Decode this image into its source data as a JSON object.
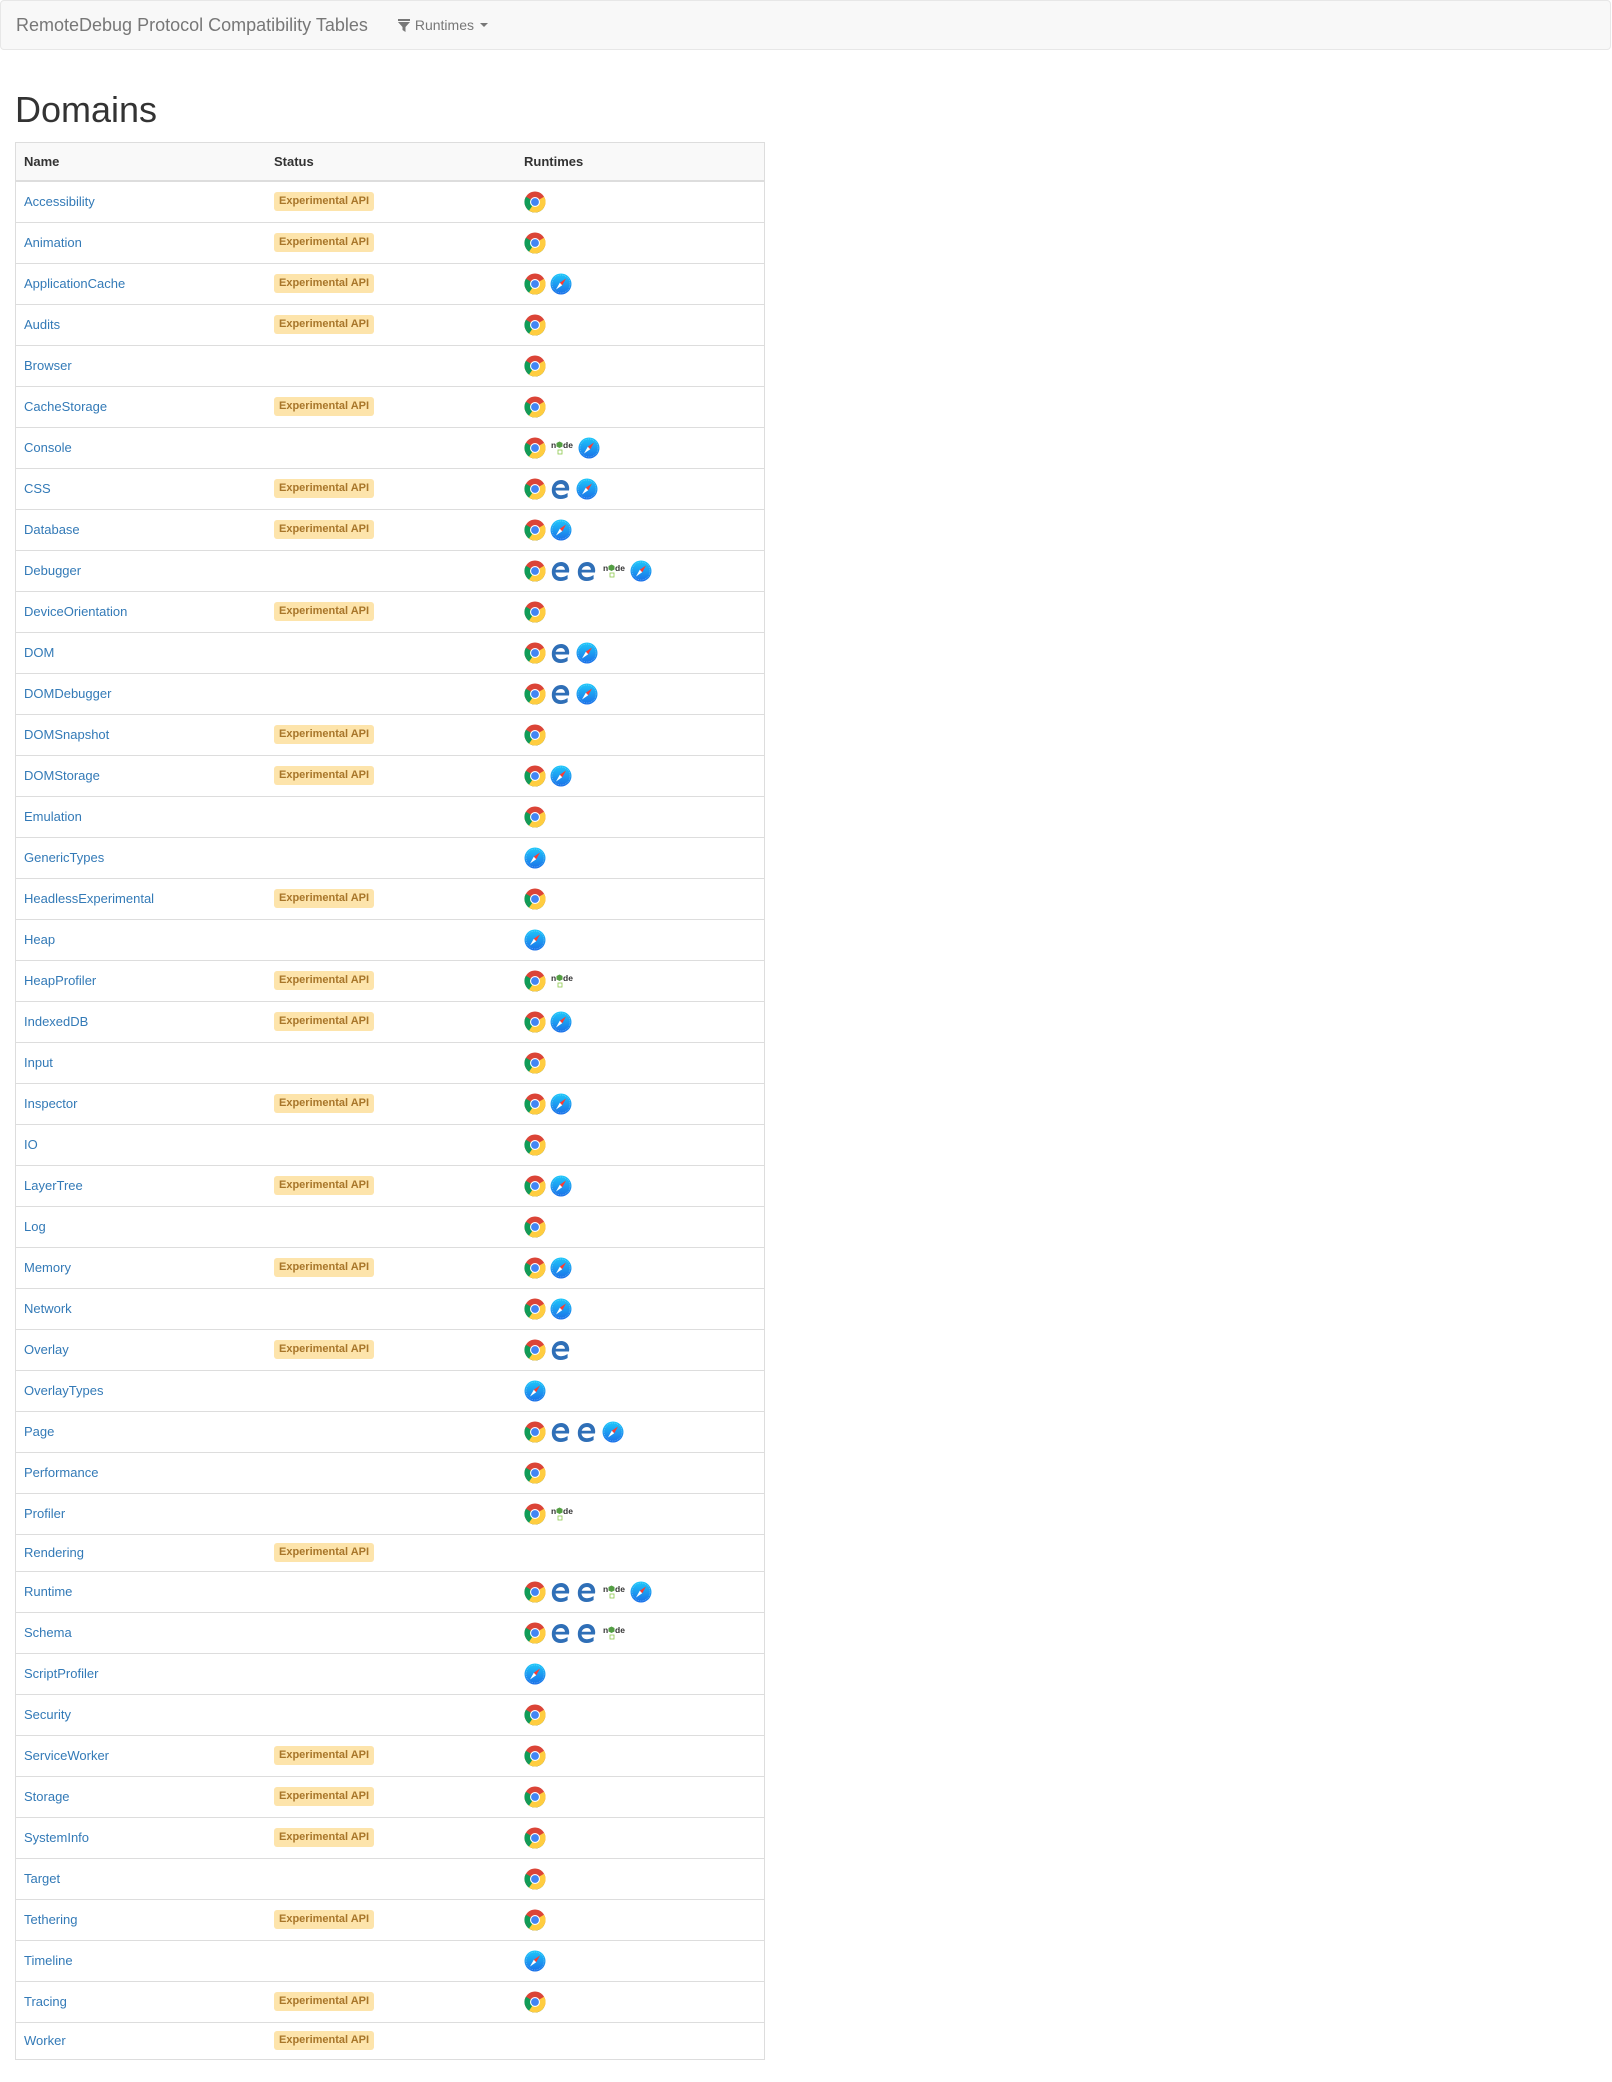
{
  "navbar": {
    "brand": "RemoteDebug Protocol Compatibility Tables",
    "runtimes_menu_label": "Runtimes",
    "runtimes_menu_icon": "filter-icon"
  },
  "page": {
    "title": "Domains"
  },
  "table": {
    "columns": [
      "Name",
      "Status",
      "Runtimes"
    ],
    "runtime_icons": {
      "chrome": "chrome-icon",
      "edge": "edge-icon",
      "node": "node-icon",
      "safari": "safari-icon"
    },
    "badge_color": "#fde4ab",
    "badge_text_color": "#a8762a",
    "link_color": "#337ab7",
    "rows": [
      {
        "name": "Accessibility",
        "status": "Experimental API",
        "runtimes": [
          "chrome"
        ]
      },
      {
        "name": "Animation",
        "status": "Experimental API",
        "runtimes": [
          "chrome"
        ]
      },
      {
        "name": "ApplicationCache",
        "status": "Experimental API",
        "runtimes": [
          "chrome",
          "safari"
        ]
      },
      {
        "name": "Audits",
        "status": "Experimental API",
        "runtimes": [
          "chrome"
        ]
      },
      {
        "name": "Browser",
        "status": "",
        "runtimes": [
          "chrome"
        ]
      },
      {
        "name": "CacheStorage",
        "status": "Experimental API",
        "runtimes": [
          "chrome"
        ]
      },
      {
        "name": "Console",
        "status": "",
        "runtimes": [
          "chrome",
          "node",
          "safari"
        ]
      },
      {
        "name": "CSS",
        "status": "Experimental API",
        "runtimes": [
          "chrome",
          "edge",
          "safari"
        ]
      },
      {
        "name": "Database",
        "status": "Experimental API",
        "runtimes": [
          "chrome",
          "safari"
        ]
      },
      {
        "name": "Debugger",
        "status": "",
        "runtimes": [
          "chrome",
          "edge",
          "edge",
          "node",
          "safari"
        ]
      },
      {
        "name": "DeviceOrientation",
        "status": "Experimental API",
        "runtimes": [
          "chrome"
        ]
      },
      {
        "name": "DOM",
        "status": "",
        "runtimes": [
          "chrome",
          "edge",
          "safari"
        ]
      },
      {
        "name": "DOMDebugger",
        "status": "",
        "runtimes": [
          "chrome",
          "edge",
          "safari"
        ]
      },
      {
        "name": "DOMSnapshot",
        "status": "Experimental API",
        "runtimes": [
          "chrome"
        ]
      },
      {
        "name": "DOMStorage",
        "status": "Experimental API",
        "runtimes": [
          "chrome",
          "safari"
        ]
      },
      {
        "name": "Emulation",
        "status": "",
        "runtimes": [
          "chrome"
        ]
      },
      {
        "name": "GenericTypes",
        "status": "",
        "runtimes": [
          "safari"
        ]
      },
      {
        "name": "HeadlessExperimental",
        "status": "Experimental API",
        "runtimes": [
          "chrome"
        ]
      },
      {
        "name": "Heap",
        "status": "",
        "runtimes": [
          "safari"
        ]
      },
      {
        "name": "HeapProfiler",
        "status": "Experimental API",
        "runtimes": [
          "chrome",
          "node"
        ]
      },
      {
        "name": "IndexedDB",
        "status": "Experimental API",
        "runtimes": [
          "chrome",
          "safari"
        ]
      },
      {
        "name": "Input",
        "status": "",
        "runtimes": [
          "chrome"
        ]
      },
      {
        "name": "Inspector",
        "status": "Experimental API",
        "runtimes": [
          "chrome",
          "safari"
        ]
      },
      {
        "name": "IO",
        "status": "",
        "runtimes": [
          "chrome"
        ]
      },
      {
        "name": "LayerTree",
        "status": "Experimental API",
        "runtimes": [
          "chrome",
          "safari"
        ]
      },
      {
        "name": "Log",
        "status": "",
        "runtimes": [
          "chrome"
        ]
      },
      {
        "name": "Memory",
        "status": "Experimental API",
        "runtimes": [
          "chrome",
          "safari"
        ]
      },
      {
        "name": "Network",
        "status": "",
        "runtimes": [
          "chrome",
          "safari"
        ]
      },
      {
        "name": "Overlay",
        "status": "Experimental API",
        "runtimes": [
          "chrome",
          "edge"
        ]
      },
      {
        "name": "OverlayTypes",
        "status": "",
        "runtimes": [
          "safari"
        ]
      },
      {
        "name": "Page",
        "status": "",
        "runtimes": [
          "chrome",
          "edge",
          "edge",
          "safari"
        ]
      },
      {
        "name": "Performance",
        "status": "",
        "runtimes": [
          "chrome"
        ]
      },
      {
        "name": "Profiler",
        "status": "",
        "runtimes": [
          "chrome",
          "node"
        ]
      },
      {
        "name": "Rendering",
        "status": "Experimental API",
        "runtimes": []
      },
      {
        "name": "Runtime",
        "status": "",
        "runtimes": [
          "chrome",
          "edge",
          "edge",
          "node",
          "safari"
        ]
      },
      {
        "name": "Schema",
        "status": "",
        "runtimes": [
          "chrome",
          "edge",
          "edge",
          "node"
        ]
      },
      {
        "name": "ScriptProfiler",
        "status": "",
        "runtimes": [
          "safari"
        ]
      },
      {
        "name": "Security",
        "status": "",
        "runtimes": [
          "chrome"
        ]
      },
      {
        "name": "ServiceWorker",
        "status": "Experimental API",
        "runtimes": [
          "chrome"
        ]
      },
      {
        "name": "Storage",
        "status": "Experimental API",
        "runtimes": [
          "chrome"
        ]
      },
      {
        "name": "SystemInfo",
        "status": "Experimental API",
        "runtimes": [
          "chrome"
        ]
      },
      {
        "name": "Target",
        "status": "",
        "runtimes": [
          "chrome"
        ]
      },
      {
        "name": "Tethering",
        "status": "Experimental API",
        "runtimes": [
          "chrome"
        ]
      },
      {
        "name": "Timeline",
        "status": "",
        "runtimes": [
          "safari"
        ]
      },
      {
        "name": "Tracing",
        "status": "Experimental API",
        "runtimes": [
          "chrome"
        ]
      },
      {
        "name": "Worker",
        "status": "Experimental API",
        "runtimes": []
      }
    ]
  }
}
